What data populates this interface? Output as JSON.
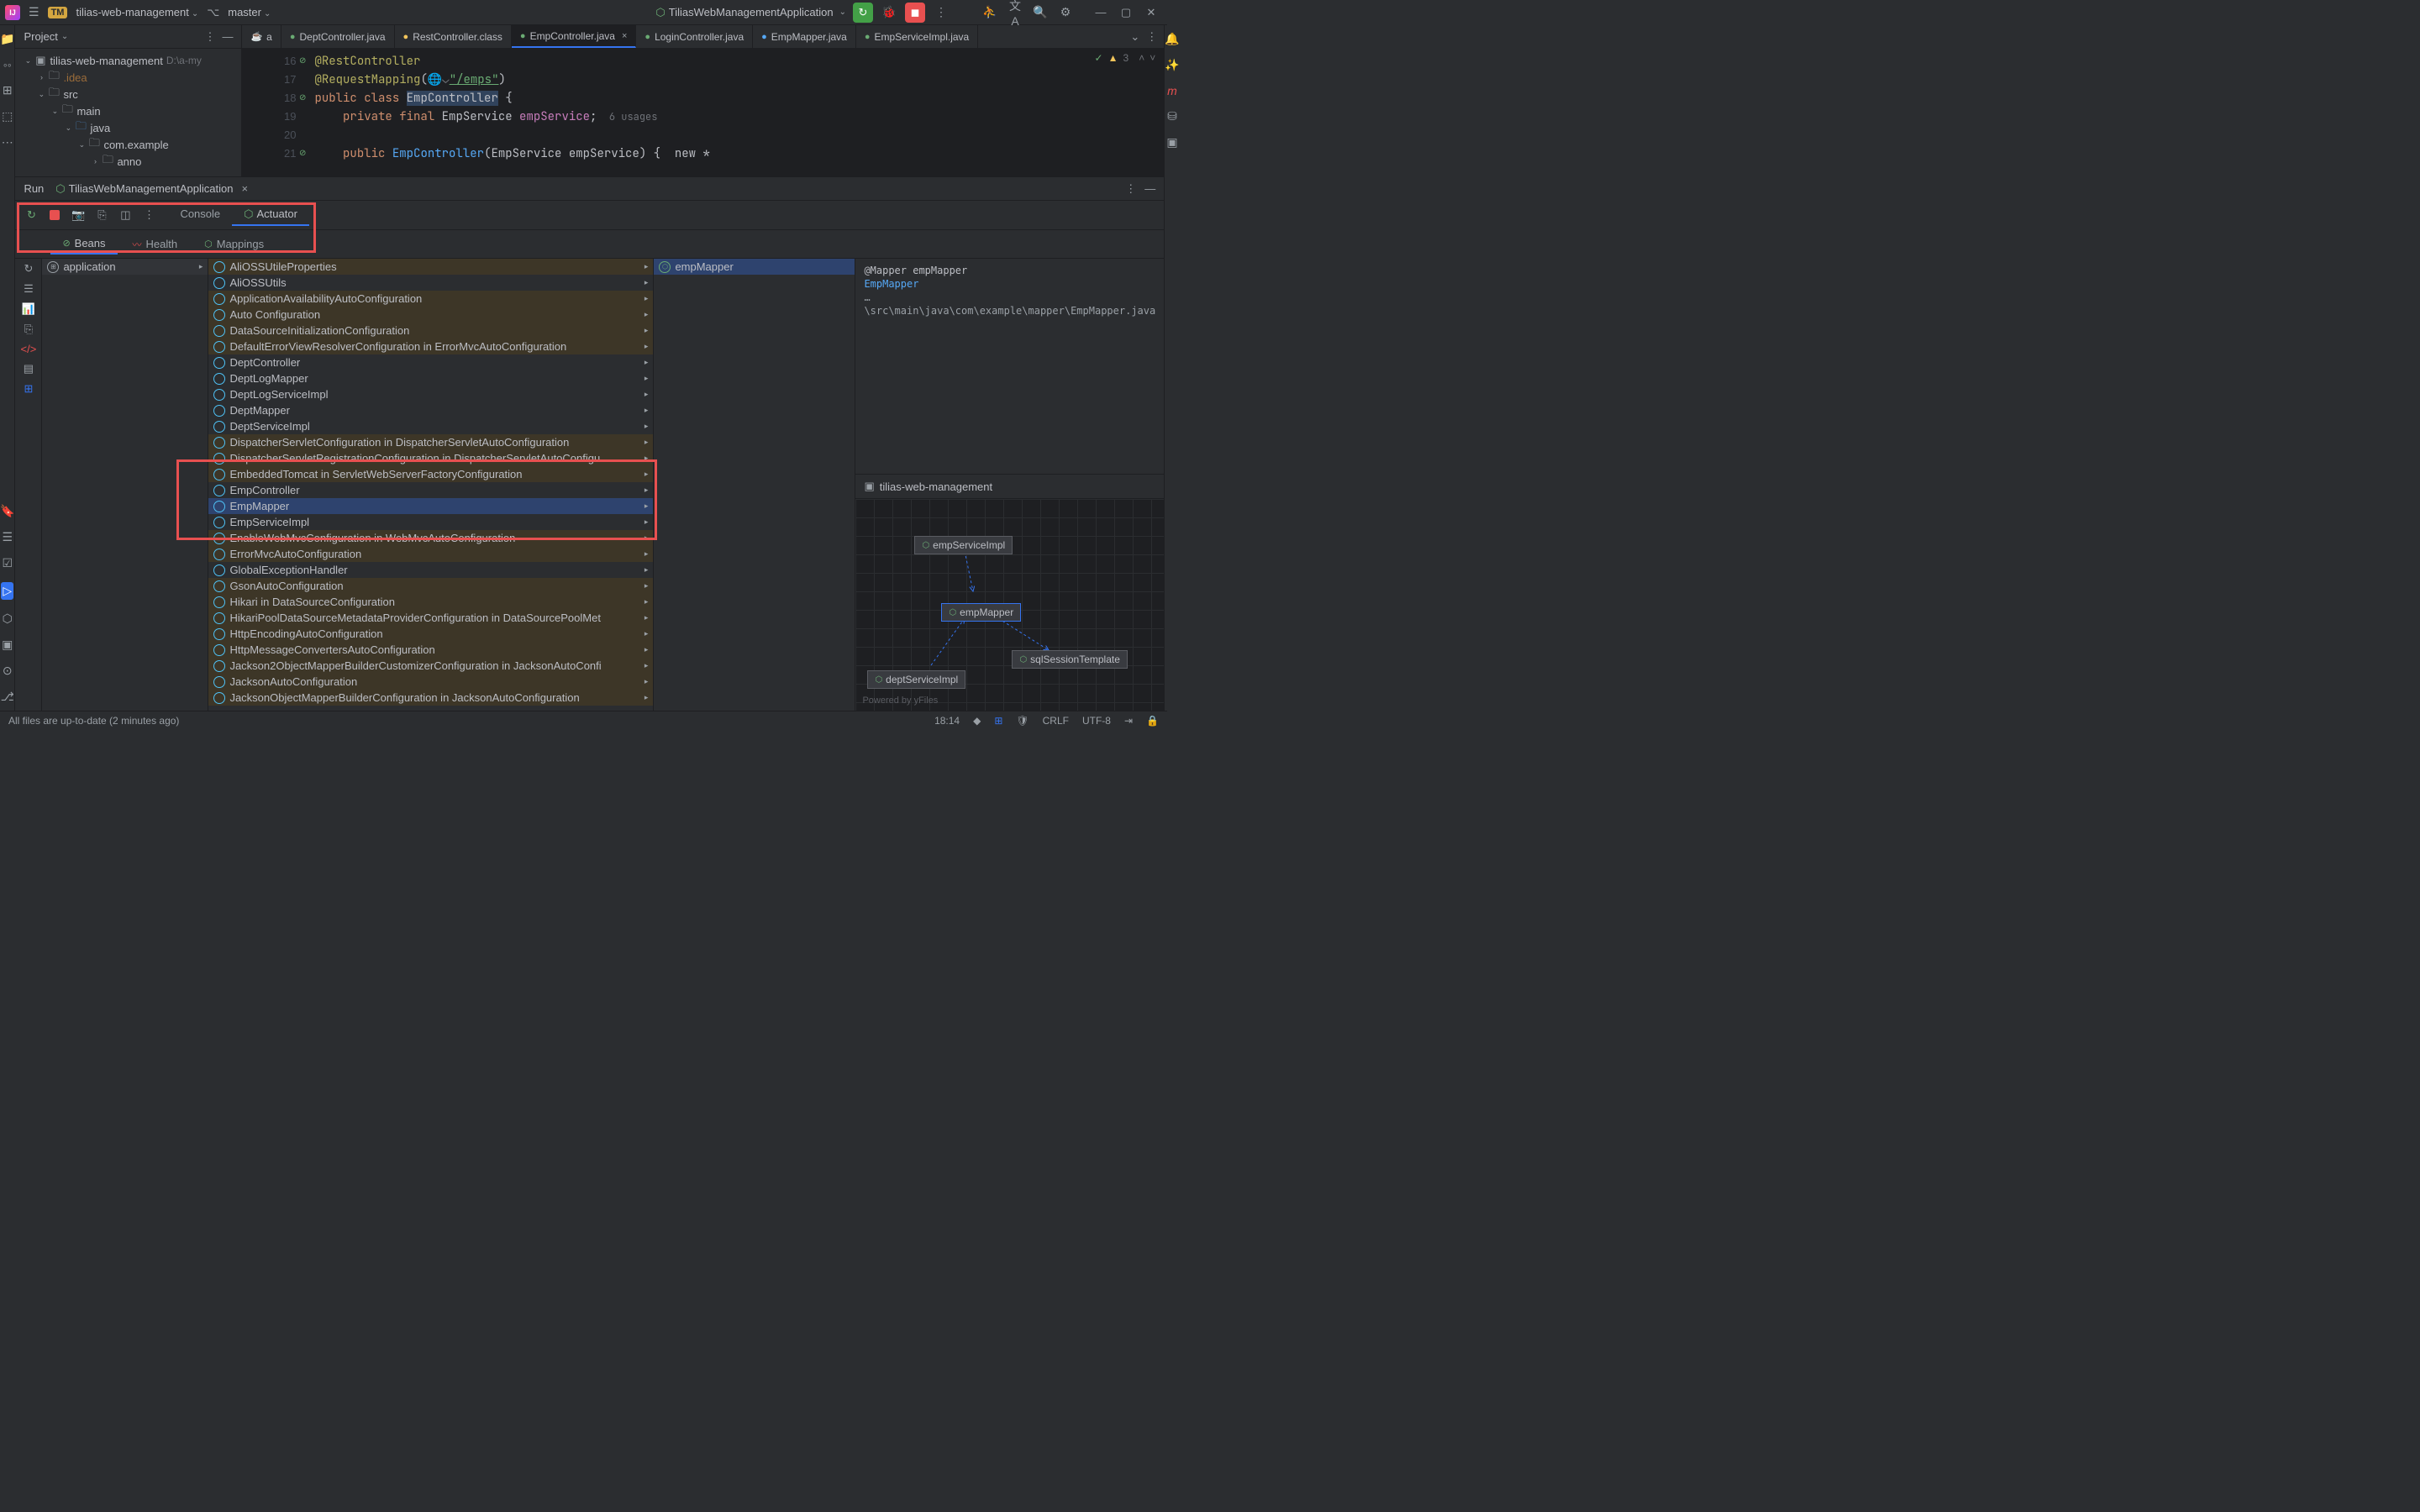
{
  "titlebar": {
    "project": "tilias-web-management",
    "branch": "master",
    "tm": "TM",
    "runConfig": "TiliasWebManagementApplication"
  },
  "projectPanel": {
    "title": "Project",
    "tree": {
      "root": "tilias-web-management",
      "rootPath": "D:\\a-my",
      "idea": ".idea",
      "src": "src",
      "main": "main",
      "java": "java",
      "pkg": "com.example",
      "anno": "anno"
    }
  },
  "editorTabs": [
    {
      "label": "a",
      "ficon": "☕"
    },
    {
      "label": "DeptController.java",
      "ficon": "●",
      "color": "#6aab73"
    },
    {
      "label": "RestController.class",
      "ficon": "●",
      "color": "#f2c55c"
    },
    {
      "label": "EmpController.java",
      "ficon": "●",
      "color": "#6aab73",
      "active": true
    },
    {
      "label": "LoginController.java",
      "ficon": "●",
      "color": "#6aab73"
    },
    {
      "label": "EmpMapper.java",
      "ficon": "●",
      "color": "#56a8f5"
    },
    {
      "label": "EmpServiceImpl.java",
      "ficon": "●",
      "color": "#6aab73"
    }
  ],
  "inspection": {
    "warnCount": "3"
  },
  "gutter": [
    "16",
    "17",
    "18",
    "19",
    "20",
    "21"
  ],
  "code": {
    "l16": {
      "anno": "@RestController"
    },
    "l17": {
      "anno": "@RequestMapping",
      "str": "\"/emps\""
    },
    "l18": {
      "kw": "public class ",
      "cls": "EmpController",
      "brace": " {"
    },
    "l19": {
      "kw": "    private final ",
      "type": "EmpService ",
      "fld": "empService",
      "semi": ";",
      "hint": "  6 usages"
    },
    "l20": "",
    "l21": {
      "kw": "    public ",
      "cls2": "EmpController",
      "sig": "(EmpService empService) {  new *"
    }
  },
  "run": {
    "title": "Run",
    "config": "TiliasWebManagementApplication",
    "tabs": {
      "console": "Console",
      "actuator": "Actuator"
    },
    "subtabs": {
      "beans": "Beans",
      "health": "Health",
      "mappings": "Mappings"
    }
  },
  "beansApp": "application",
  "beans": [
    {
      "n": "AliOSSUtileProperties",
      "hl": true
    },
    {
      "n": "AliOSSUtils"
    },
    {
      "n": "ApplicationAvailabilityAutoConfiguration",
      "hl": true
    },
    {
      "n": "Auto Configuration",
      "hl": true
    },
    {
      "n": "DataSourceInitializationConfiguration",
      "hl": true
    },
    {
      "n": "DefaultErrorViewResolverConfiguration in ErrorMvcAutoConfiguration",
      "hl": true
    },
    {
      "n": "DeptController"
    },
    {
      "n": "DeptLogMapper"
    },
    {
      "n": "DeptLogServiceImpl"
    },
    {
      "n": "DeptMapper"
    },
    {
      "n": "DeptServiceImpl"
    },
    {
      "n": "DispatcherServletConfiguration in DispatcherServletAutoConfiguration",
      "hl": true
    },
    {
      "n": "DispatcherServletRegistrationConfiguration in DispatcherServletAutoConfigu",
      "hl": true
    },
    {
      "n": "EmbeddedTomcat in ServletWebServerFactoryConfiguration",
      "hl": true
    },
    {
      "n": "EmpController"
    },
    {
      "n": "EmpMapper",
      "sel": true
    },
    {
      "n": "EmpServiceImpl"
    },
    {
      "n": "EnableWebMvcConfiguration in WebMvcAutoConfiguration",
      "hl": true
    },
    {
      "n": "ErrorMvcAutoConfiguration",
      "hl": true
    },
    {
      "n": "GlobalExceptionHandler"
    },
    {
      "n": "GsonAutoConfiguration",
      "hl": true
    },
    {
      "n": "Hikari in DataSourceConfiguration",
      "hl": true
    },
    {
      "n": "HikariPoolDataSourceMetadataProviderConfiguration in DataSourcePoolMet",
      "hl": true
    },
    {
      "n": "HttpEncodingAutoConfiguration",
      "hl": true
    },
    {
      "n": "HttpMessageConvertersAutoConfiguration",
      "hl": true
    },
    {
      "n": "Jackson2ObjectMapperBuilderCustomizerConfiguration in JacksonAutoConfi",
      "hl": true
    },
    {
      "n": "JacksonAutoConfiguration",
      "hl": true
    },
    {
      "n": "JacksonObjectMapperBuilderConfiguration in JacksonAutoConfiguration",
      "hl": true
    }
  ],
  "selBean": "empMapper",
  "detail": {
    "l1": "@Mapper empMapper",
    "l2": "EmpMapper",
    "l3": "…\\src\\main\\java\\com\\example\\mapper\\EmpMapper.java"
  },
  "diagram": {
    "title": "tilias-web-management",
    "nodes": {
      "n1": "empServiceImpl",
      "n2": "empMapper",
      "n3": "sqlSessionTemplate",
      "n4": "deptServiceImpl"
    },
    "powered": "Powered by yFiles"
  },
  "status": {
    "msg": "All files are up-to-date (2 minutes ago)",
    "time": "18:14",
    "crlf": "CRLF",
    "enc": "UTF-8"
  }
}
